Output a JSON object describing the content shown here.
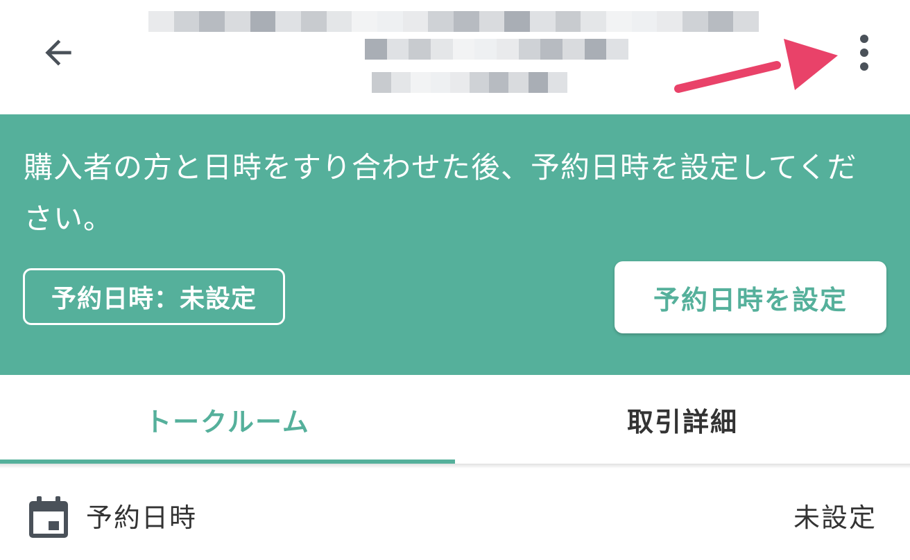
{
  "header": {
    "back_icon": "arrow-left-icon",
    "more_icon": "more-vert-icon",
    "annotation_arrow_color": "#e94269"
  },
  "banner": {
    "message": "購入者の方と日時をすり合わせた後、予約日時を設定してください。",
    "status_chip": "予約日時：未設定",
    "set_button": "予約日時を設定",
    "background_color": "#55b09b"
  },
  "tabs": [
    {
      "label": "トークルーム",
      "active": true
    },
    {
      "label": "取引詳細",
      "active": false
    }
  ],
  "reservation": {
    "icon": "calendar-icon",
    "label": "予約日時",
    "value": "未設定"
  },
  "colors": {
    "accent": "#55b09b",
    "text": "#333333",
    "icon": "#4a5159"
  }
}
